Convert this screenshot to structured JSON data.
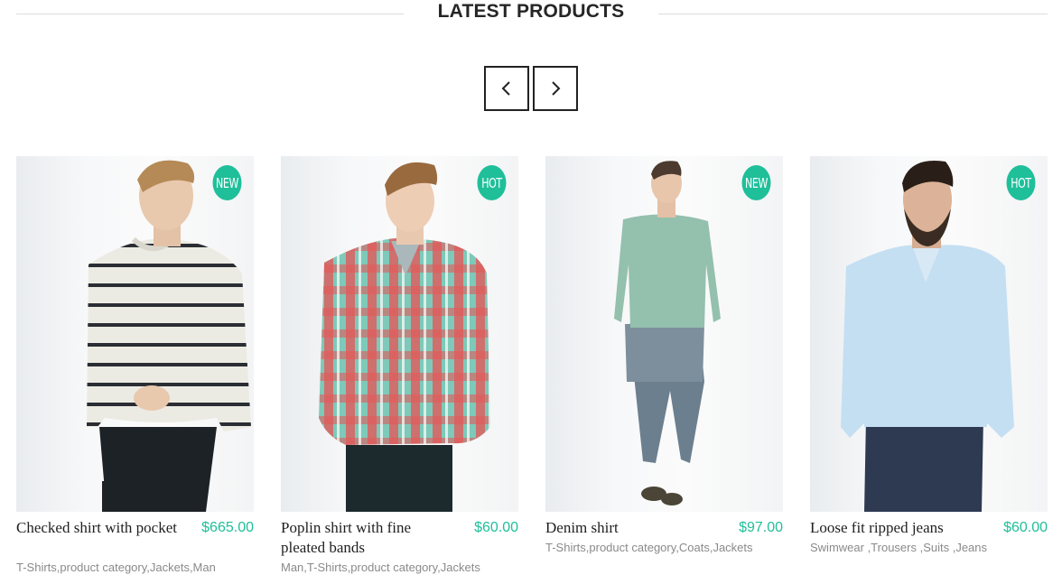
{
  "section": {
    "title": "LATEST PRODUCTS",
    "prev_icon": "chevron-left-icon",
    "next_icon": "chevron-right-icon"
  },
  "colors": {
    "accent": "#1fbf9a",
    "text": "#262626",
    "muted": "#8a8a8a"
  },
  "products": [
    {
      "name": "Checked shirt with pocket",
      "price": "$665.00",
      "badge": "NEW",
      "categories": "T-Shirts,product category,Jackets,Man",
      "image": "man-striped-sweater-photo"
    },
    {
      "name": "Poplin shirt with fine pleated bands",
      "price": "$60.00",
      "badge": "HOT",
      "categories": "Man,T-Shirts,product category,Jackets",
      "image": "man-plaid-shirt-photo"
    },
    {
      "name": "Denim shirt",
      "price": "$97.00",
      "badge": "NEW",
      "categories": "T-Shirts,product category,Coats,Jackets",
      "image": "man-green-sweater-jeans-photo"
    },
    {
      "name": "Loose fit ripped jeans",
      "price": "$60.00",
      "badge": "HOT",
      "categories": "Swimwear ,Trousers ,Suits ,Jeans",
      "image": "man-light-blue-shirt-photo"
    }
  ]
}
